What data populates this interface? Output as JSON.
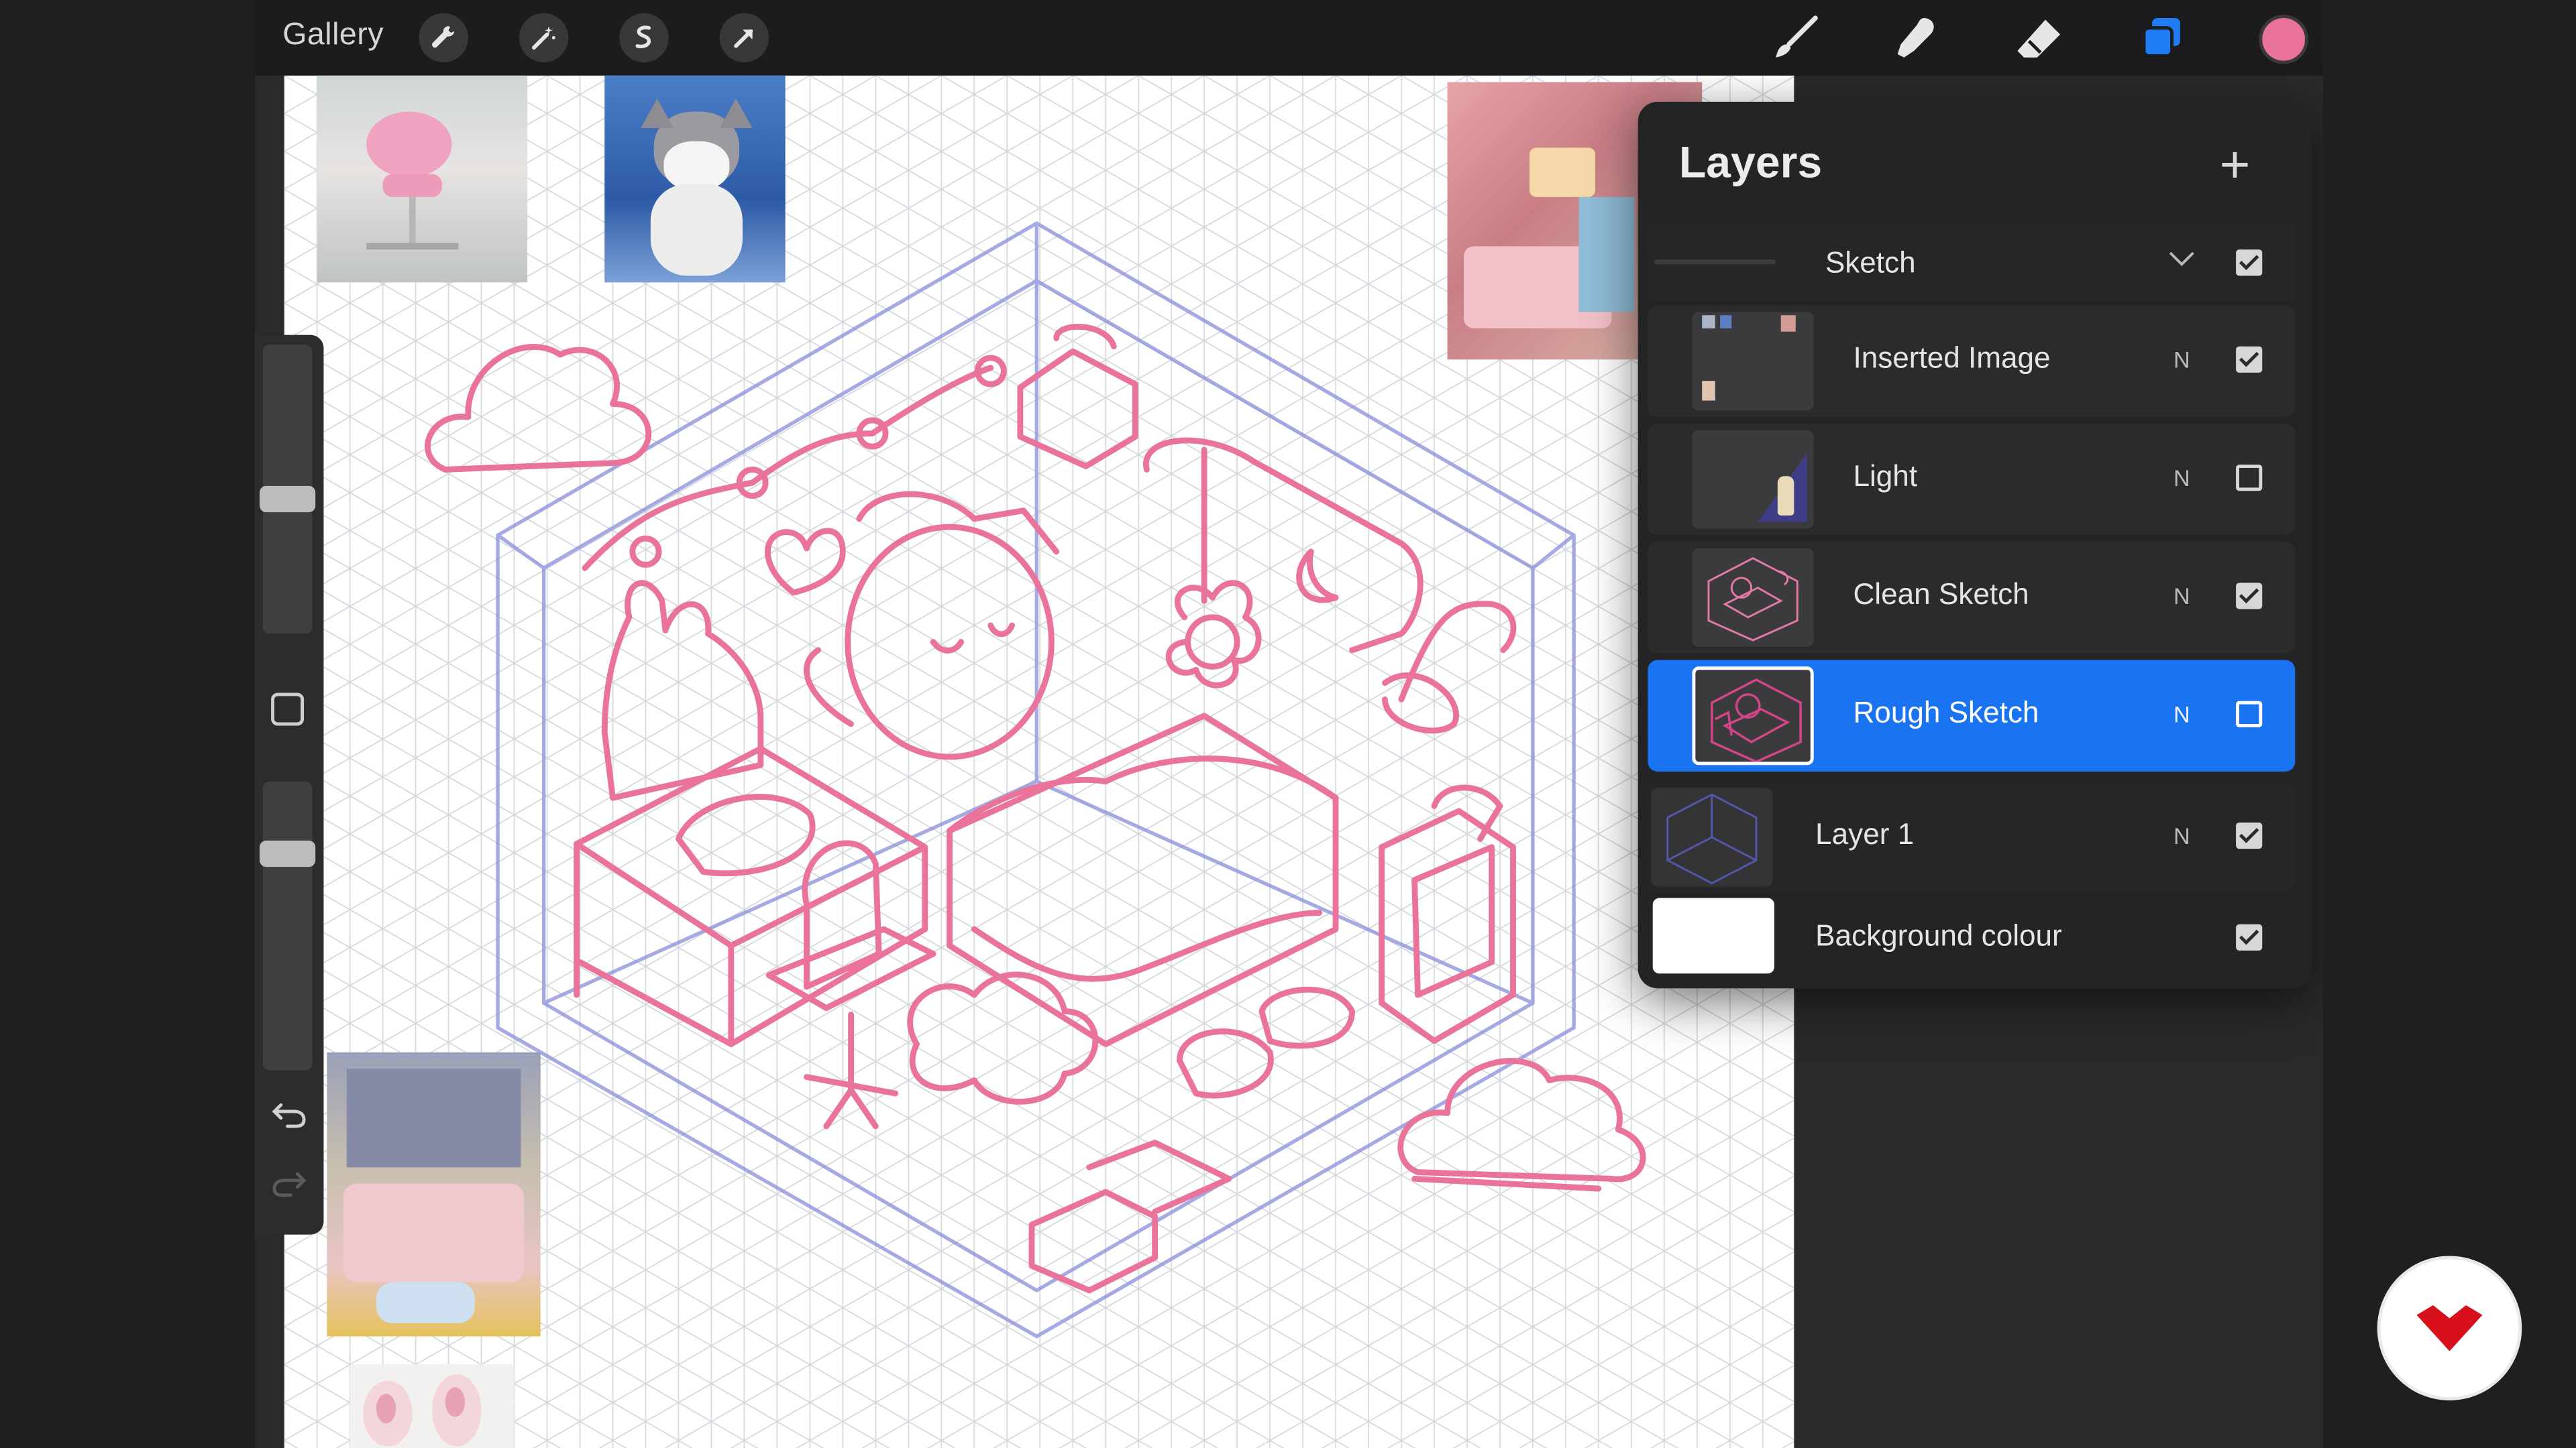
{
  "toolbar": {
    "gallery_label": "Gallery",
    "left_tools": [
      "wrench-icon",
      "magic-wand-icon",
      "selection-icon",
      "transform-arrow-icon"
    ],
    "right_tools": [
      "brush-icon",
      "smudge-icon",
      "eraser-icon",
      "layers-icon"
    ],
    "current_color": "#e9739a",
    "layers_icon_color": "#1f7cf5"
  },
  "sidebar": {
    "brush_size_level": 0.45,
    "opacity_level": 0.25,
    "modifier_icon": "square-modifier-icon",
    "undo_icon": "undo-icon",
    "redo_icon": "redo-icon"
  },
  "layers_panel": {
    "title": "Layers",
    "add_icon": "plus-icon",
    "group": {
      "name": "Sketch",
      "checked": true,
      "expand_icon": "chevron-down-icon"
    },
    "layers": [
      {
        "name": "Inserted Image",
        "blend": "N",
        "checked": true,
        "active": false
      },
      {
        "name": "Light",
        "blend": "N",
        "checked": false,
        "active": false
      },
      {
        "name": "Clean Sketch",
        "blend": "N",
        "checked": true,
        "active": false
      },
      {
        "name": "Rough Sketch",
        "blend": "N",
        "checked": false,
        "active": true
      },
      {
        "name": "Layer 1",
        "blend": "N",
        "checked": true,
        "active": false
      },
      {
        "name": "Background colour",
        "blend": "",
        "checked": true,
        "active": false
      }
    ]
  },
  "canvas": {
    "sketch_color": "#e9739a",
    "guide_color": "#8f95dc",
    "grid_color": "#cfd2d8"
  },
  "reference_photos": [
    "pink-chair-photo",
    "cat-photo",
    "pink-room-photo",
    "bedroom-photo",
    "slippers-photo"
  ],
  "watermark": {
    "icon": "domestika-logo-icon",
    "color": "#d8101b"
  }
}
